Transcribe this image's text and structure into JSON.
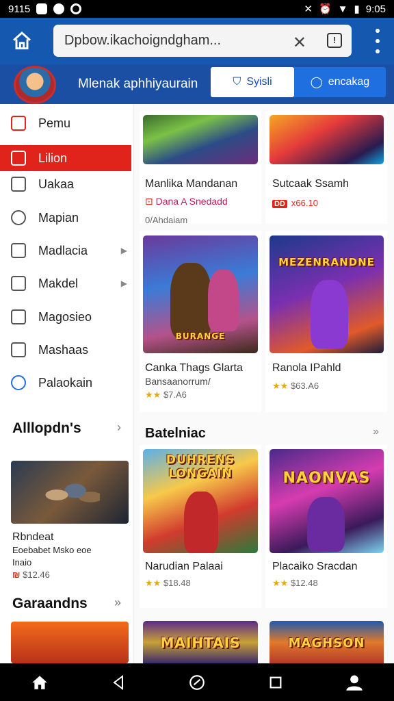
{
  "status": {
    "left_time": "9115",
    "right_time": "9:05"
  },
  "browser": {
    "url": "Dpbow.ikachoigndgham...",
    "tab_count": "!"
  },
  "profile": {
    "name": "Mlenak aphhiyaurain",
    "btn_outline": "Syisli",
    "btn_primary": "encakag"
  },
  "sidebar": {
    "items": [
      {
        "label": "Pemu",
        "icon": "home-icon"
      },
      {
        "label": "Lilion",
        "icon": "calendar-icon",
        "active": true
      },
      {
        "label": "Uakaa",
        "icon": "square-icon"
      },
      {
        "label": "Mapian",
        "icon": "gear-icon"
      },
      {
        "label": "Madlacia",
        "icon": "house-icon",
        "chevron": true
      },
      {
        "label": "Makdel",
        "icon": "document-icon",
        "chevron": true
      },
      {
        "label": "Magosieo",
        "icon": "mail-icon"
      },
      {
        "label": "Mashaas",
        "icon": "list-icon"
      },
      {
        "label": "Palaokain",
        "icon": "refresh-icon"
      }
    ],
    "section1": {
      "title": "Alllopdn's"
    },
    "card": {
      "title": "Rbndeat",
      "subtitle": "Eoebabet Msko eoe",
      "meta": "Inaio",
      "price": "$12.46"
    },
    "section2": {
      "title": "Garaandns"
    }
  },
  "main": {
    "row1": [
      {
        "title": "Manlika Mandanan",
        "sub": "Dana A Snedadd",
        "meta": "0/Ahdaiam"
      },
      {
        "title": "Sutcaak Ssamh",
        "price": "x66.10"
      }
    ],
    "row2": [
      {
        "title": "Canka Thags Glarta",
        "sub": "Bansaanorrum/",
        "price": "$7.A6",
        "art": "BURANGE"
      },
      {
        "title": "Ranola IPahld",
        "price": "$63.A6",
        "art": "MEZENRANDNE"
      }
    ],
    "section": {
      "title": "Batelniac"
    },
    "row3": [
      {
        "title": "Narudian Palaai",
        "price": "$18.48",
        "art": "DUHRENS LONGAIN"
      },
      {
        "title": "Placaiko Sracdan",
        "price": "$12.48",
        "art": "NAONVAS"
      }
    ],
    "row4": [
      {
        "art": "MAIHTAIS"
      },
      {
        "art": "MAGHSON"
      }
    ]
  },
  "colors": {
    "accent_red": "#e0231b",
    "brand_blue": "#1a4fa3",
    "button_blue": "#1f6fe0"
  }
}
